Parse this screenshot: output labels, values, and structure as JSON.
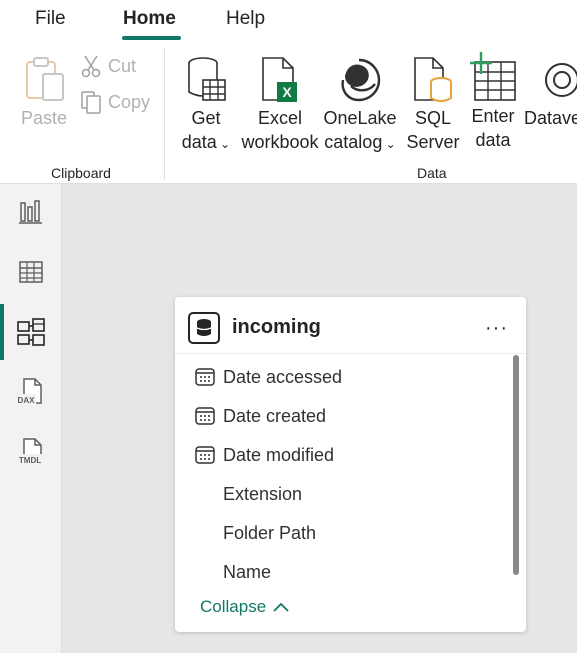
{
  "menu": {
    "tabs": [
      {
        "label": "File"
      },
      {
        "label": "Home"
      },
      {
        "label": "Help"
      }
    ],
    "active": "Home"
  },
  "ribbon": {
    "clipboard": {
      "group_label": "Clipboard",
      "paste": "Paste",
      "cut": "Cut",
      "copy": "Copy"
    },
    "data": {
      "group_label": "Data",
      "get_data": [
        "Get",
        "data"
      ],
      "excel": [
        "Excel",
        "workbook"
      ],
      "onelake": [
        "OneLake",
        "catalog"
      ],
      "sql": [
        "SQL",
        "Server"
      ],
      "enter": [
        "Enter",
        "data"
      ],
      "dataverse": "Datave"
    }
  },
  "rail": {
    "items": [
      "report-view-icon",
      "table-view-icon",
      "model-view-icon",
      "dax-query-icon",
      "tmdl-view-icon"
    ],
    "dax_label": "DAX",
    "tmdl_label": "TMDL",
    "active": "model-view-icon"
  },
  "card": {
    "title": "incoming",
    "more": "···",
    "fields": [
      {
        "label": "Date accessed",
        "icon": "calendar-icon"
      },
      {
        "label": "Date created",
        "icon": "calendar-icon"
      },
      {
        "label": "Date modified",
        "icon": "calendar-icon"
      },
      {
        "label": "Extension",
        "icon": ""
      },
      {
        "label": "Folder Path",
        "icon": ""
      },
      {
        "label": "Name",
        "icon": ""
      }
    ],
    "collapse_label": "Collapse"
  },
  "colors": {
    "accent": "#117865",
    "excel_green": "#107c41",
    "sql_orange": "#e8a33d"
  }
}
